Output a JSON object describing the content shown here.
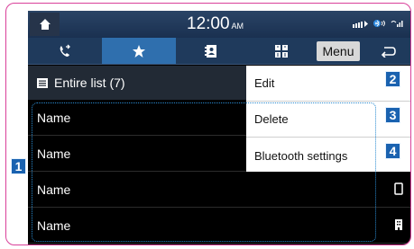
{
  "status": {
    "time": "12:00",
    "ampm": "AM"
  },
  "icons": {
    "home": "home-icon",
    "tab_calls": "call-log-icon",
    "tab_favorites": "star-icon",
    "tab_contacts": "contacts-icon",
    "tab_keypad": "keypad-icon",
    "back": "back-arrow-icon"
  },
  "toolbar": {
    "menu_label": "Menu"
  },
  "list": {
    "header": "Entire list (7)",
    "rows": [
      {
        "name": "Name"
      },
      {
        "name": "Name"
      },
      {
        "name": "Name"
      },
      {
        "name": "Name"
      }
    ]
  },
  "menu": {
    "items": [
      {
        "label": "Edit"
      },
      {
        "label": "Delete"
      },
      {
        "label": "Bluetooth settings"
      }
    ]
  },
  "callouts": [
    "1",
    "2",
    "3",
    "4"
  ],
  "colors": {
    "accent": "#2f6fae",
    "callout": "#1a62b0",
    "frame": "#d9409a"
  }
}
